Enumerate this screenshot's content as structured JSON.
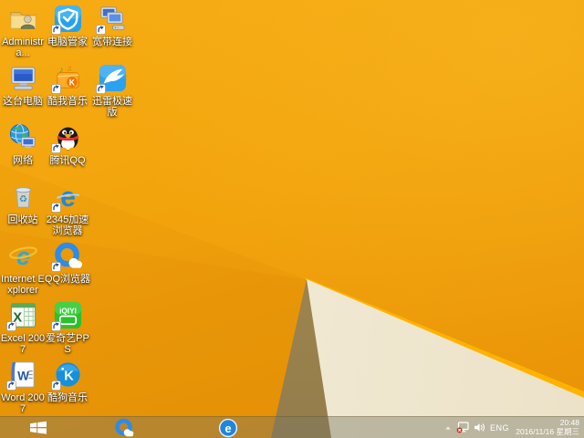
{
  "wallpaper": {
    "description": "Windows 8.1 default orange folded-paper wallpaper",
    "colors": {
      "orange_top": "#f6ac13",
      "orange_bottom": "#e89206",
      "fold_cream": "#f3eddb",
      "fold_olive": "#a2874f",
      "ridge_highlight": "#ffb300"
    }
  },
  "desktop": {
    "icons": [
      {
        "name": "administrator-folder",
        "label": "Administra...",
        "type": "user-folder",
        "shortcut": false,
        "col": 0,
        "row": 0
      },
      {
        "name": "pc-manager",
        "label": "电脑管家",
        "type": "pc-manager",
        "shortcut": true,
        "col": 1,
        "row": 0
      },
      {
        "name": "broadband-connection",
        "label": "宽带连接",
        "type": "broadband",
        "shortcut": true,
        "col": 2,
        "row": 0
      },
      {
        "name": "this-pc",
        "label": "这台电脑",
        "type": "computer",
        "shortcut": false,
        "col": 0,
        "row": 1
      },
      {
        "name": "kuwo-music",
        "label": "酷我音乐",
        "type": "kuwo",
        "glyph": "K",
        "shortcut": true,
        "col": 1,
        "row": 1
      },
      {
        "name": "thunder-speed-edition",
        "label": "迅雷极速版",
        "type": "thunder",
        "shortcut": true,
        "col": 2,
        "row": 1
      },
      {
        "name": "network",
        "label": "网络",
        "type": "network",
        "shortcut": false,
        "col": 0,
        "row": 2
      },
      {
        "name": "tencent-qq",
        "label": "腾讯QQ",
        "type": "qq",
        "shortcut": true,
        "col": 1,
        "row": 2
      },
      {
        "name": "recycle-bin",
        "label": "回收站",
        "type": "recycle",
        "shortcut": false,
        "col": 0,
        "row": 3
      },
      {
        "name": "2345-speed-browser",
        "label": "2345加速浏览器",
        "type": "e-browser",
        "glyph": "e",
        "shortcut": true,
        "col": 1,
        "row": 3
      },
      {
        "name": "internet-explorer",
        "label": "Internet Explorer",
        "type": "ie",
        "glyph": "e",
        "shortcut": false,
        "col": 0,
        "row": 4
      },
      {
        "name": "qq-browser",
        "label": "QQ浏览器",
        "type": "qq-browser",
        "shortcut": true,
        "col": 1,
        "row": 4
      },
      {
        "name": "excel-2007",
        "label": "Excel 2007",
        "type": "excel",
        "glyph": "X",
        "shortcut": true,
        "col": 0,
        "row": 5
      },
      {
        "name": "iqiyi-pps",
        "label": "爱奇艺PPS",
        "type": "iqiyi",
        "glyph": "iQIYI",
        "shortcut": true,
        "col": 1,
        "row": 5
      },
      {
        "name": "word-2007",
        "label": "Word 2007",
        "type": "word",
        "glyph": "W",
        "shortcut": true,
        "col": 0,
        "row": 6
      },
      {
        "name": "kugou-music",
        "label": "酷狗音乐",
        "type": "kugou",
        "glyph": "K",
        "shortcut": true,
        "col": 1,
        "row": 6
      }
    ]
  },
  "taskbar": {
    "buttons": [
      {
        "name": "start-button",
        "type": "start"
      },
      {
        "name": "taskbar-qq-browser",
        "type": "qq-browser-pinned"
      },
      {
        "name": "taskbar-2345-browser",
        "type": "e-circle",
        "glyph": "e"
      }
    ],
    "tray": {
      "language": "ENG",
      "time": "20:48",
      "date": "2016/11/16 星期三"
    }
  }
}
